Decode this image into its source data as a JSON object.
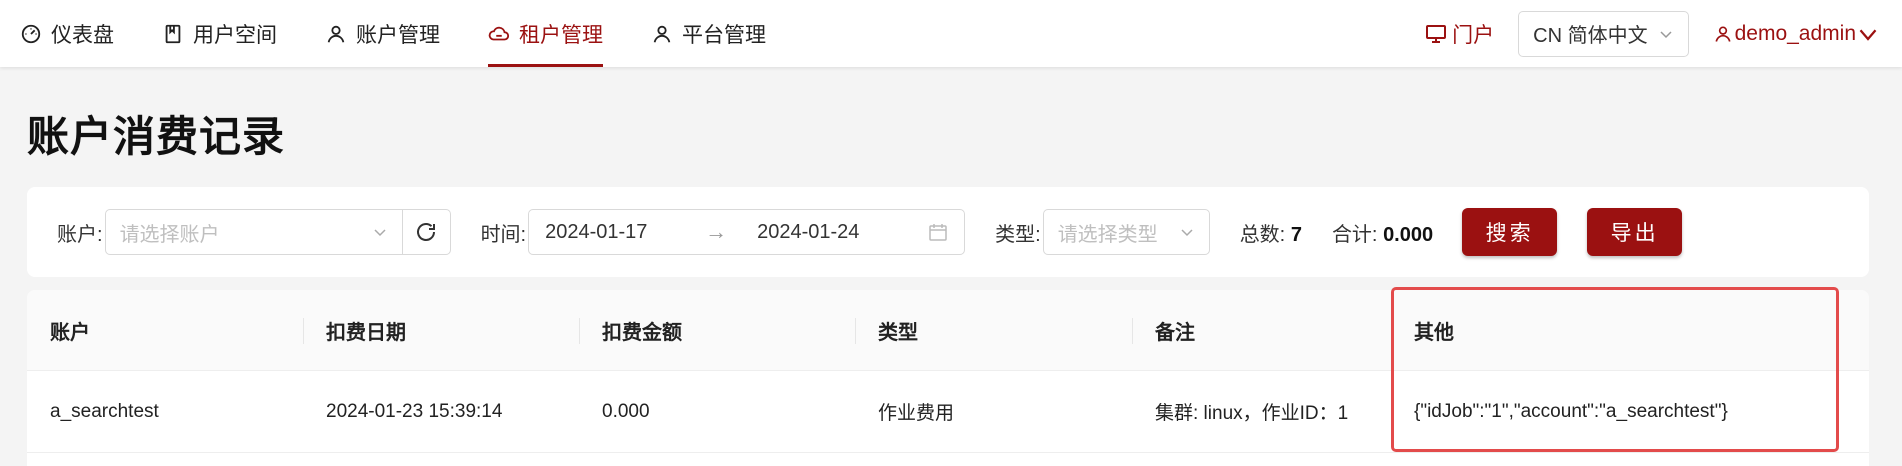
{
  "nav": {
    "items": [
      {
        "label": "仪表盘",
        "icon": "dashboard-icon"
      },
      {
        "label": "用户空间",
        "icon": "book-icon"
      },
      {
        "label": "账户管理",
        "icon": "user-icon"
      },
      {
        "label": "租户管理",
        "icon": "cloud-icon",
        "active": true
      },
      {
        "label": "平台管理",
        "icon": "user-icon"
      }
    ]
  },
  "header": {
    "portal_label": "门户",
    "language_label": "CN 简体中文",
    "username": "demo_admin"
  },
  "page": {
    "title": "账户消费记录"
  },
  "filters": {
    "account_label": "账户:",
    "account_placeholder": "请选择账户",
    "time_label": "时间:",
    "start_date": "2024-01-17",
    "end_date": "2024-01-24",
    "range_arrow": "→",
    "type_label": "类型:",
    "type_placeholder": "请选择类型",
    "total_count_label": "总数:",
    "total_count": "7",
    "total_sum_label": "合计:",
    "total_sum": "0.000",
    "search_button": "搜索",
    "export_button": "导出"
  },
  "table": {
    "columns": [
      "账户",
      "扣费日期",
      "扣费金额",
      "类型",
      "备注",
      "其他"
    ],
    "rows": [
      [
        "a_searchtest",
        "2024-01-23 15:39:14",
        "0.000",
        "作业费用",
        "集群: linux，作业ID：1",
        "{\"idJob\":\"1\",\"account\":\"a_searchtest\"}"
      ]
    ]
  },
  "colors": {
    "brand": "#9b1111",
    "highlight": "#e34b4b",
    "background": "#f4f4f4"
  }
}
